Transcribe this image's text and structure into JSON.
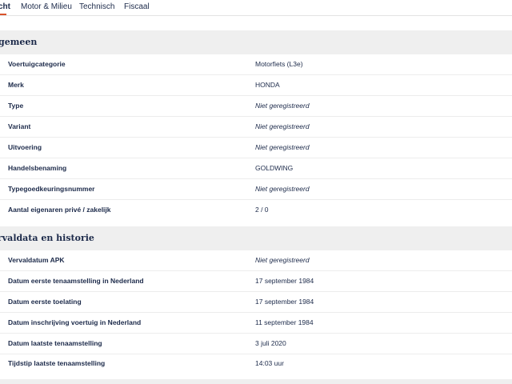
{
  "tabs": [
    {
      "label": "cht",
      "active": true
    },
    {
      "label": "Motor & Milieu",
      "active": false
    },
    {
      "label": "Technisch",
      "active": false
    },
    {
      "label": "Fiscaal",
      "active": false
    }
  ],
  "colors": {
    "accent": "#d9522b",
    "text": "#1c2a4a",
    "section_bg": "#efefef"
  },
  "sections": [
    {
      "title": "gemeen",
      "rows": [
        {
          "label": "Voertuigcategorie",
          "value": "Motorfiets (L3e)",
          "italic": false
        },
        {
          "label": "Merk",
          "value": "HONDA",
          "italic": false
        },
        {
          "label": "Type",
          "value": "Niet geregistreerd",
          "italic": true
        },
        {
          "label": "Variant",
          "value": "Niet geregistreerd",
          "italic": true
        },
        {
          "label": "Uitvoering",
          "value": "Niet geregistreerd",
          "italic": true
        },
        {
          "label": "Handelsbenaming",
          "value": "GOLDWING",
          "italic": false
        },
        {
          "label": "Typegoedkeuringsnummer",
          "value": "Niet geregistreerd",
          "italic": true
        },
        {
          "label": "Aantal eigenaren privé / zakelijk",
          "value": "2 / 0",
          "italic": false
        }
      ]
    },
    {
      "title": "rvaldata en historie",
      "rows": [
        {
          "label": "Vervaldatum APK",
          "value": "Niet geregistreerd",
          "italic": true
        },
        {
          "label": "Datum eerste tenaamstelling in Nederland",
          "value": "17 september 1984",
          "italic": false
        },
        {
          "label": "Datum eerste toelating",
          "value": "17 september 1984",
          "italic": false
        },
        {
          "label": "Datum inschrijving voertuig in Nederland",
          "value": "11 september 1984",
          "italic": false
        },
        {
          "label": "Datum laatste tenaamstelling",
          "value": "3 juli 2020",
          "italic": false
        },
        {
          "label": "Tijdstip laatste tenaamstelling",
          "value": "14:03 uur",
          "italic": false
        }
      ]
    }
  ]
}
